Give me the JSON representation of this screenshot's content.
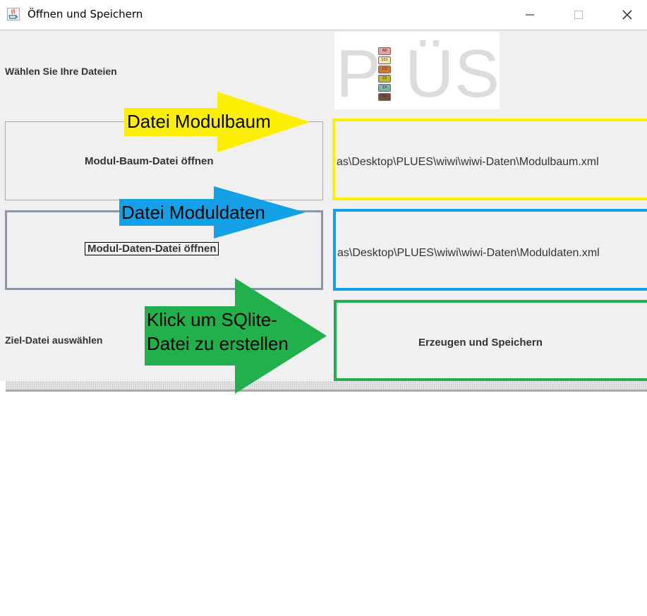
{
  "window": {
    "title": "Öffnen und Speichern"
  },
  "labels": {
    "choose_files": "Wählen Sie Ihre Dateien",
    "target_file": "Ziel-Datei auswählen"
  },
  "buttons": {
    "open_module_tree": "Modul-Baum-Datei öffnen",
    "open_module_data": "Modul-Daten-Datei öffnen",
    "create_and_save": "Erzeugen und Speichern"
  },
  "paths": {
    "module_tree": "as\\Desktop\\PLUES\\wiwi\\wiwi-Daten\\Modulbaum.xml",
    "module_data": "as\\Desktop\\PLUES\\wiwi\\wiwi-Daten\\Moduldaten.xml"
  },
  "annotations": {
    "modulbaum": "Datei Modulbaum",
    "moduldaten": "Datei Moduldaten",
    "sqlite_line1": "Klick um SQlite-",
    "sqlite_line2": "Datei zu erstellen"
  },
  "logo": {
    "letters": [
      "P",
      "Ü",
      "S"
    ],
    "bars": [
      "AB",
      "101",
      "C2",
      "22",
      "19",
      "84"
    ],
    "bar_colors": [
      "#e9a2a2",
      "#f4e9a7",
      "#d2753a",
      "#b8b832",
      "#7fb3a8",
      "#7a4a3c"
    ]
  },
  "colors": {
    "yellow": "#fcf000",
    "blue": "#14a0e6",
    "green": "#22b04c",
    "panel_border": "#8a96a8"
  }
}
